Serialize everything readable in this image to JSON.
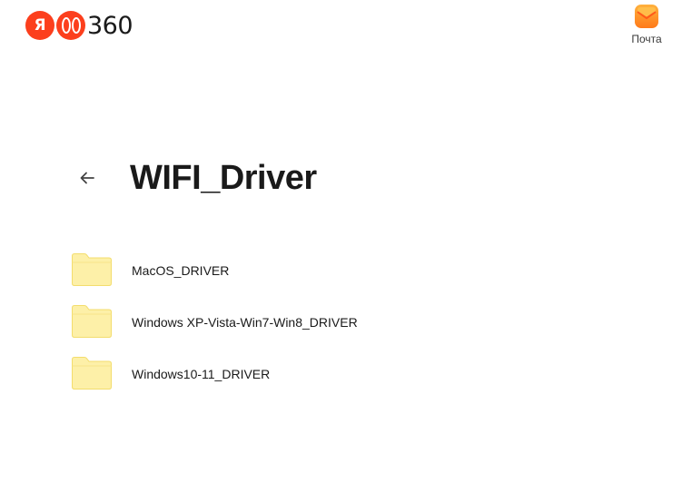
{
  "header": {
    "logo": {
      "ya_letter": "Я",
      "product": "360"
    },
    "mail_label": "Почта"
  },
  "folder": {
    "title": "WIFI_Driver"
  },
  "items": [
    {
      "name": "MacOS_DRIVER",
      "icon": "folder-icon"
    },
    {
      "name": "Windows XP-Vista-Win7-Win8_DRIVER",
      "icon": "folder-icon"
    },
    {
      "name": "Windows10-11_DRIVER",
      "icon": "folder-icon"
    }
  ],
  "colors": {
    "brand_red": "#fc3f1d",
    "folder_fill": "#fdf0a8",
    "folder_stroke": "#f3dd6d",
    "mail_orange": "#ff8c1a"
  }
}
